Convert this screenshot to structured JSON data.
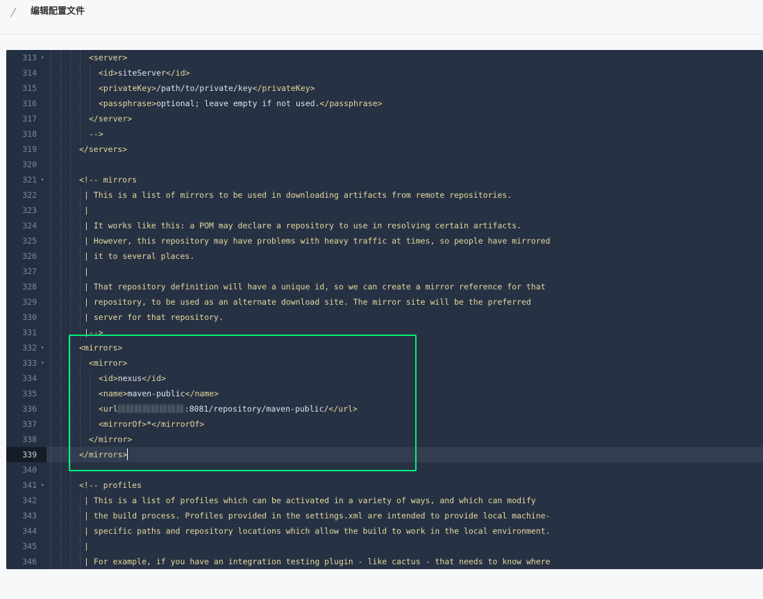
{
  "header": {
    "title": "编辑配置文件",
    "icon": "pencil-icon"
  },
  "colors": {
    "editor_bg": "#263143",
    "gutter_bg": "#233042",
    "tag": "#e6d89e",
    "text": "#dfe3ea",
    "highlight": "#00ef7a"
  },
  "editor": {
    "active_line": "339",
    "lines": [
      {
        "num": "313",
        "fold": "▾",
        "segs": [
          [
            "t",
            "<server>"
          ]
        ]
      },
      {
        "num": "314",
        "segs": [
          [
            "t",
            "<id>"
          ],
          [
            "x",
            "siteServer"
          ],
          [
            "t",
            "</id>"
          ]
        ]
      },
      {
        "num": "315",
        "segs": [
          [
            "t",
            "<privateKey>"
          ],
          [
            "x",
            "/path/to/private/key"
          ],
          [
            "t",
            "</privateKey>"
          ]
        ]
      },
      {
        "num": "316",
        "segs": [
          [
            "t",
            "<passphrase>"
          ],
          [
            "x",
            "optional; leave empty if not used."
          ],
          [
            "t",
            "</passphrase>"
          ]
        ]
      },
      {
        "num": "317",
        "segs": [
          [
            "t",
            "</server>"
          ]
        ]
      },
      {
        "num": "318",
        "segs": [
          [
            "c",
            "-->"
          ]
        ]
      },
      {
        "num": "319",
        "segs": [
          [
            "t",
            "</servers>"
          ]
        ]
      },
      {
        "num": "320",
        "segs": []
      },
      {
        "num": "321",
        "fold": "▾",
        "segs": [
          [
            "c",
            "<!-- mirrors"
          ]
        ]
      },
      {
        "num": "322",
        "segs": [
          [
            "c",
            "| This is a list of mirrors to be used in downloading artifacts from remote repositories."
          ]
        ]
      },
      {
        "num": "323",
        "segs": [
          [
            "c",
            "|"
          ]
        ]
      },
      {
        "num": "324",
        "segs": [
          [
            "c",
            "| It works like this: a POM may declare a repository to use in resolving certain artifacts."
          ]
        ]
      },
      {
        "num": "325",
        "segs": [
          [
            "c",
            "| However, this repository may have problems with heavy traffic at times, so people have mirrored"
          ]
        ]
      },
      {
        "num": "326",
        "segs": [
          [
            "c",
            "| it to several places."
          ]
        ]
      },
      {
        "num": "327",
        "segs": [
          [
            "c",
            "|"
          ]
        ]
      },
      {
        "num": "328",
        "segs": [
          [
            "c",
            "| That repository definition will have a unique id, so we can create a mirror reference for that"
          ]
        ]
      },
      {
        "num": "329",
        "segs": [
          [
            "c",
            "| repository, to be used as an alternate download site. The mirror site will be the preferred"
          ]
        ]
      },
      {
        "num": "330",
        "segs": [
          [
            "c",
            "| server for that repository."
          ]
        ]
      },
      {
        "num": "331",
        "segs": [
          [
            "c",
            "|-->"
          ]
        ]
      },
      {
        "num": "332",
        "fold": "▾",
        "segs": [
          [
            "t",
            "<mirrors>"
          ]
        ]
      },
      {
        "num": "333",
        "fold": "▾",
        "segs": [
          [
            "t",
            "<mirror>"
          ]
        ]
      },
      {
        "num": "334",
        "segs": [
          [
            "t",
            "<id>"
          ],
          [
            "x",
            "nexus"
          ],
          [
            "t",
            "</id>"
          ]
        ]
      },
      {
        "num": "335",
        "segs": [
          [
            "t",
            "<name>"
          ],
          [
            "x",
            "maven-public"
          ],
          [
            "t",
            "</name>"
          ]
        ]
      },
      {
        "num": "336",
        "segs": [
          [
            "t",
            "<url"
          ],
          [
            "b",
            ""
          ],
          [
            "x",
            ":8081/repository/maven-public/"
          ],
          [
            "t",
            "</url>"
          ]
        ]
      },
      {
        "num": "337",
        "segs": [
          [
            "t",
            "<mirrorOf>"
          ],
          [
            "x",
            "*"
          ],
          [
            "t",
            "</mirrorOf>"
          ]
        ]
      },
      {
        "num": "338",
        "segs": [
          [
            "t",
            "</mirror>"
          ]
        ]
      },
      {
        "num": "339",
        "segs": [
          [
            "t",
            "</mirrors>"
          ]
        ]
      },
      {
        "num": "340",
        "segs": []
      },
      {
        "num": "341",
        "fold": "▾",
        "segs": [
          [
            "c",
            "<!-- profiles"
          ]
        ]
      },
      {
        "num": "342",
        "segs": [
          [
            "c",
            "| This is a list of profiles which can be activated in a variety of ways, and which can modify"
          ]
        ]
      },
      {
        "num": "343",
        "segs": [
          [
            "c",
            "| the build process. Profiles provided in the settings.xml are intended to provide local machine-"
          ]
        ]
      },
      {
        "num": "344",
        "segs": [
          [
            "c",
            "| specific paths and repository locations which allow the build to work in the local environment."
          ]
        ]
      },
      {
        "num": "345",
        "segs": [
          [
            "c",
            "|"
          ]
        ]
      },
      {
        "num": "346",
        "segs": [
          [
            "c",
            "| For example, if you have an integration testing plugin - like cactus - that needs to know where"
          ]
        ]
      }
    ]
  }
}
